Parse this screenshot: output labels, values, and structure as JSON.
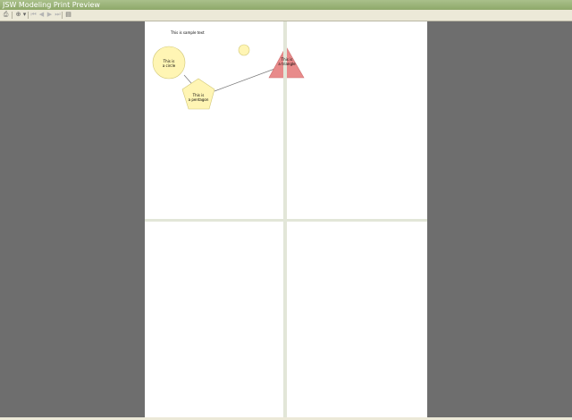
{
  "window": {
    "title": "JSW Modeling Print Preview"
  },
  "toolbar": {
    "buttons": [
      {
        "name": "print-icon",
        "glyph": "⎙",
        "enabled": true
      },
      {
        "name": "zoom-icon",
        "glyph": "⊕",
        "enabled": true
      },
      {
        "name": "dropdown-arrow-icon",
        "glyph": "▾",
        "enabled": true
      },
      {
        "name": "first-page-icon",
        "glyph": "⏮",
        "enabled": false
      },
      {
        "name": "previous-page-icon",
        "glyph": "◀",
        "enabled": false
      },
      {
        "name": "next-page-icon",
        "glyph": "▶",
        "enabled": false
      },
      {
        "name": "last-page-icon",
        "glyph": "⏭",
        "enabled": false
      },
      {
        "name": "page-setup-icon",
        "glyph": "▤",
        "enabled": true
      }
    ]
  },
  "canvas": {
    "text": "This is sample text",
    "circle_label": "This is\na circle",
    "pentagon_label": "This is\na pentagon",
    "triangle_label": "This is\na triangle",
    "colors": {
      "circle_fill": "#fff5b4",
      "circle_stroke": "#d2c878",
      "pentagon_fill": "#fff5b4",
      "triangle_fill": "#e88a8a",
      "connector": "#777777",
      "page_background": "#ffffff",
      "viewport_background": "#6e6e6e",
      "page_break": "#e2e6d8"
    }
  }
}
